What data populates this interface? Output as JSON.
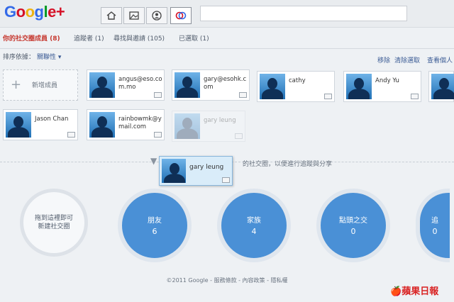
{
  "header": {
    "logo_text": "Google+",
    "nav_icons": [
      "home-icon",
      "photos-icon",
      "profile-icon",
      "circles-icon"
    ],
    "search_placeholder": ""
  },
  "tabs": [
    {
      "label": "你的社交圈成員 (8)",
      "active": true
    },
    {
      "label": "追蹤者 (1)",
      "active": false
    },
    {
      "label": "尋找與邀請 (105)",
      "active": false
    },
    {
      "label": "已選取 (1)",
      "active": false
    }
  ],
  "sortbar": {
    "label": "排序依據：",
    "value": "關聯性 ▾",
    "actions": [
      "移除",
      "清除選取",
      "查看個人"
    ]
  },
  "contacts": {
    "add_label": "新增成員",
    "cards": [
      {
        "name": "angus@eso.com.mo"
      },
      {
        "name": "gary@esohk.com"
      },
      {
        "name": "cathy"
      },
      {
        "name": "Andy Yu"
      },
      {
        "name": "Jason Chan"
      },
      {
        "name": "rainbowmk@ymail.com"
      },
      {
        "name": "gary leung"
      }
    ]
  },
  "drag": {
    "name": "gary leung",
    "hint": "的社交圈，以便進行追蹤與分享"
  },
  "circles": {
    "new_label": "拖到這裡即可新建社交圈",
    "items": [
      {
        "name": "朋友",
        "count": "6"
      },
      {
        "name": "家族",
        "count": "4"
      },
      {
        "name": "點頭之交",
        "count": "0"
      },
      {
        "name": "追",
        "count": "0"
      }
    ]
  },
  "footer": {
    "text": "©2011 Google - 服務條款 - 內容政策 - 隱私權"
  },
  "watermark": {
    "text": "蘋果日報"
  },
  "colors": {
    "accent": "#4a90d6",
    "active_tab": "#c6382f",
    "link": "#3b5b94"
  }
}
